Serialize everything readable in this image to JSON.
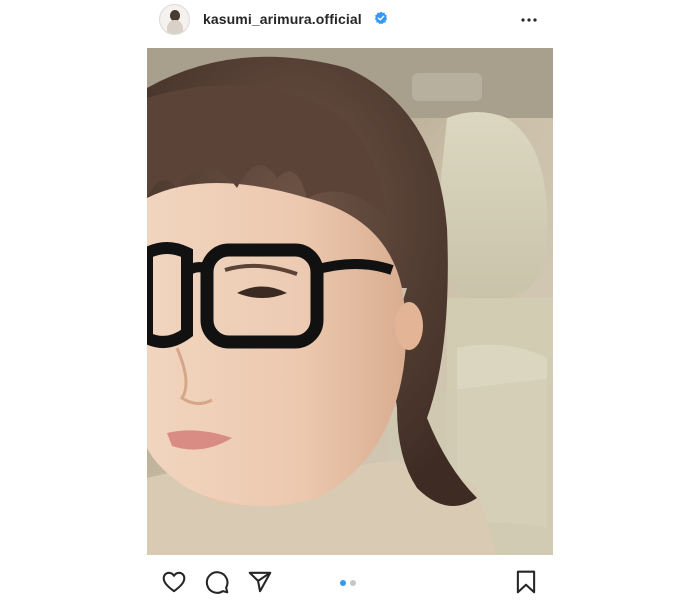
{
  "post": {
    "username": "kasumi_arimura.official",
    "verified_icon": "verified-badge-icon",
    "more_icon": "more-options-icon",
    "photo_alt": "",
    "actions": {
      "like_icon": "heart-icon",
      "comment_icon": "comment-icon",
      "share_icon": "send-icon",
      "save_icon": "bookmark-icon"
    },
    "carousel": {
      "total": 2,
      "active_index": 0
    },
    "colors": {
      "verified_blue": "#3897f0",
      "dot_active": "#3897f0",
      "dot_inactive": "#c7c7c7",
      "icon": "#262626"
    }
  }
}
